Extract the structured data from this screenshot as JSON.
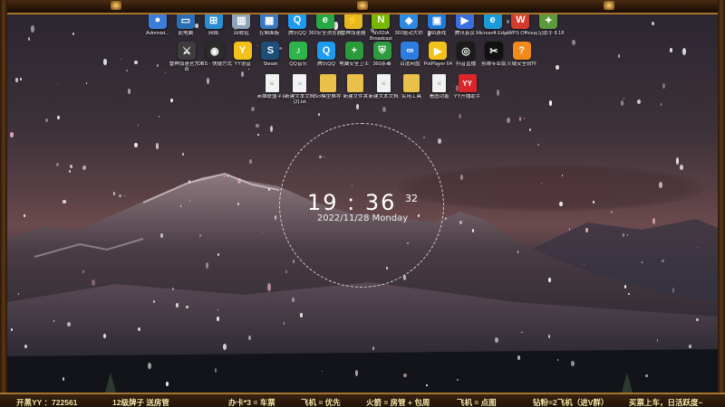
{
  "desktop": {
    "row1": [
      {
        "label": "Administ...",
        "color": "#3b7dd8",
        "glyph": "●",
        "icon": "user-folder-icon"
      },
      {
        "label": "此电脑",
        "color": "#2a6fb3",
        "glyph": "▭",
        "icon": "computer-icon"
      },
      {
        "label": "网络",
        "color": "#2a8fd0",
        "glyph": "⊞",
        "icon": "network-icon"
      },
      {
        "label": "回收站",
        "color": "#8fa3b8",
        "glyph": "▥",
        "icon": "recycle-bin-icon"
      },
      {
        "label": "控制面板",
        "color": "#3a78c2",
        "glyph": "▦",
        "icon": "control-panel-icon"
      },
      {
        "label": "腾讯QQ",
        "color": "#1d9bf0",
        "glyph": "Q",
        "icon": "qq-icon"
      },
      {
        "label": "360安全浏览器",
        "color": "#27a844",
        "glyph": "e",
        "icon": "browser-icon"
      },
      {
        "label": "雷神加速器",
        "color": "#e8b820",
        "glyph": "⚡",
        "icon": "accelerator-icon"
      },
      {
        "label": "NVIDIA Broadcast",
        "color": "#76b900",
        "glyph": "N",
        "icon": "nvidia-icon"
      },
      {
        "label": "360驱动大师",
        "color": "#2d8ae0",
        "glyph": "◆",
        "icon": "driver-icon"
      },
      {
        "label": "360游戏",
        "color": "#1e7ad6",
        "glyph": "▣",
        "icon": "game-icon"
      },
      {
        "label": "腾讯会议",
        "color": "#3a6fe0",
        "glyph": "▶",
        "icon": "meeting-icon"
      },
      {
        "label": "Microsoft Edge",
        "color": "#1a9ad6",
        "glyph": "e",
        "icon": "edge-icon"
      },
      {
        "label": "WPS Office",
        "color": "#d33b2a",
        "glyph": "W",
        "icon": "wps-icon"
      },
      {
        "label": "云记助手 8.18",
        "color": "#5a9a3a",
        "glyph": "✦",
        "icon": "assistant-icon"
      }
    ],
    "row2": [
      {
        "label": "雷神加速官方平台",
        "color": "#3d3d3d",
        "glyph": "⚔",
        "icon": "game-platform-icon"
      },
      {
        "label": "OBS - 快捷方式",
        "color": "#2b2b2b",
        "glyph": "◉",
        "icon": "obs-icon"
      },
      {
        "label": "YY语音",
        "color": "#f2c21a",
        "glyph": "Y",
        "icon": "yy-icon"
      },
      {
        "label": "Steam",
        "color": "#1b4f7a",
        "glyph": "S",
        "icon": "steam-icon"
      },
      {
        "label": "QQ音乐",
        "color": "#2fb34b",
        "glyph": "♪",
        "icon": "music-icon"
      },
      {
        "label": "腾讯QQ",
        "color": "#1d9bf0",
        "glyph": "Q",
        "icon": "qq-icon"
      },
      {
        "label": "电脑安全卫士",
        "color": "#2a9a3a",
        "glyph": "+",
        "icon": "security-icon"
      },
      {
        "label": "360杀毒",
        "color": "#2f9a40",
        "glyph": "⛨",
        "icon": "antivirus-icon"
      },
      {
        "label": "百度网盘",
        "color": "#2f7de0",
        "glyph": "∞",
        "icon": "cloud-drive-icon"
      },
      {
        "label": "PotPlayer 64",
        "color": "#f2c21a",
        "glyph": "▶",
        "icon": "player-icon"
      },
      {
        "label": "抖音直播",
        "color": "#1a1a1a",
        "glyph": "◎",
        "icon": "live-icon"
      },
      {
        "label": "剪映专业版",
        "color": "#111111",
        "glyph": "✂",
        "icon": "editor-icon"
      },
      {
        "label": "火绒安全软件",
        "color": "#f08a1a",
        "glyph": "?",
        "icon": "help-app-icon"
      }
    ],
    "row3": [
      {
        "label": "英雄联盟平台",
        "icon": "document-icon"
      },
      {
        "label": "新建文本文档 (2).txt",
        "icon": "document-icon"
      },
      {
        "label": "Sci模型推荐",
        "icon": "folder-icon"
      },
      {
        "label": "新建文件夹",
        "icon": "folder-icon"
      },
      {
        "label": "新建文本文档",
        "icon": "document-icon"
      },
      {
        "label": "实用工具",
        "icon": "folder-icon"
      },
      {
        "label": "看图功能",
        "icon": "document-icon"
      },
      {
        "label": "YY开播助手",
        "icon": "stream-assistant-icon"
      }
    ]
  },
  "clock": {
    "hour": "19",
    "minute": "36",
    "second": "32",
    "date": "2022/11/28 Monday"
  },
  "bottom_bar": [
    {
      "text": "开黑YY ：722561"
    },
    {
      "text": "12级牌子 送房管"
    },
    {
      "text": "办卡*3 = 车票"
    },
    {
      "text": "飞机 = 优先"
    },
    {
      "text": "火箭 = 房管 + 包周"
    },
    {
      "text": "飞机 = 点图"
    },
    {
      "text": "钻粉=2飞机（进V群）"
    },
    {
      "text": "买票上车，日活跃度~"
    }
  ]
}
